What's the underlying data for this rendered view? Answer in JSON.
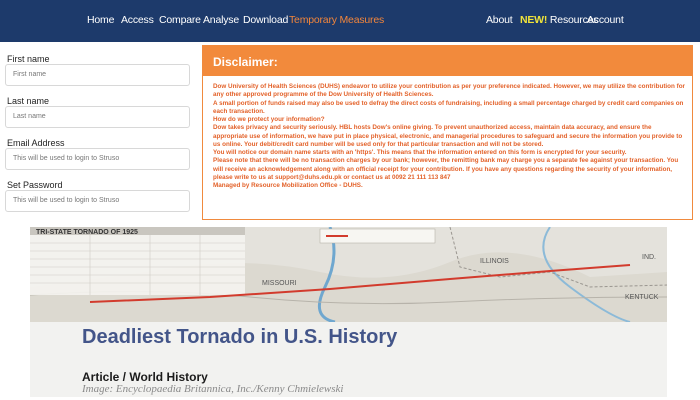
{
  "nav": {
    "left": [
      "Home",
      "Access",
      "Compare",
      "Analyse",
      "Download",
      "Temporary Measures"
    ],
    "about": "About",
    "new_badge": "NEW!",
    "resources": "Resources",
    "account": "Account",
    "active": "Temporary Measures",
    "bg_color": "#1d3a6b",
    "active_color": "#f2853b",
    "new_color": "#f0e33a"
  },
  "form": {
    "first_name_label": "First name",
    "first_name_placeholder": "First name",
    "last_name_label": "Last name",
    "last_name_placeholder": "Last name",
    "email_label": "Email Address",
    "email_placeholder": "This will be used to login to Struso",
    "password_label": "Set Password",
    "password_placeholder": "This will be used to login to Struso"
  },
  "disclaimer": {
    "title": "Disclaimer:",
    "header_color": "#f28a3c",
    "text_color": "#e3622a",
    "lines": [
      "Dow University of Health Sciences (DUHS) endeavor to utilize your contribution as per your preference indicated. However, we may utilize the contribution for any other approved programme of the Dow University of Health Sciences.",
      "A small portion of funds raised may also be used to defray the direct costs of fundraising, including a small percentage charged by credit card companies on each transaction.",
      "How do we protect your information?",
      "Dow takes privacy and security seriously. HBL hosts Dow's online giving. To prevent unauthorized access, maintain data accuracy, and ensure the appropriate use of information, we have put in place physical, electronic, and managerial procedures to safeguard and secure the information you provide to us online. Your debit/credit card number will be used only for that particular transaction and will not be stored.",
      "You will notice our domain name starts with an 'https'. This means that the information entered on this form is encrypted for your security.",
      "Please note that there will be no transaction charges by our bank; however, the remitting bank may charge you a separate fee against your transaction. You will receive an acknowledgement along with an official receipt for your contribution. If you have any questions regarding the security of your information, please write to us at support@duhs.edu.pk or contact us at 0092 21 111 113 847",
      "Managed by Resource Mobilization Office - DUHS."
    ]
  },
  "article": {
    "title": "Deadliest Tornado in U.S. History",
    "subtitle": "Article / World History",
    "credit": "Image: Encyclopaedia Britannica, Inc./Kenny Chmielewski",
    "map_labels": {
      "table_title": "TRI-STATE TORNADO OF 1925",
      "illinois": "ILLINOIS",
      "indiana": "IND.",
      "missouri": "MISSOURI",
      "kentucky": "KENTUCK"
    }
  }
}
